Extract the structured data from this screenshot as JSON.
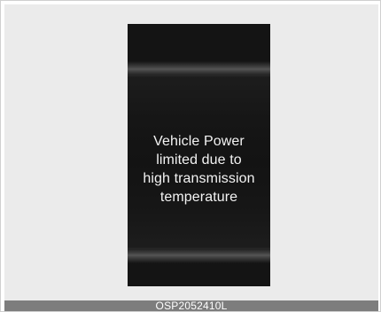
{
  "display": {
    "message": "Vehicle Power\nlimited due to\nhigh transmission\ntemperature"
  },
  "caption": {
    "code": "OSP2052410L"
  }
}
